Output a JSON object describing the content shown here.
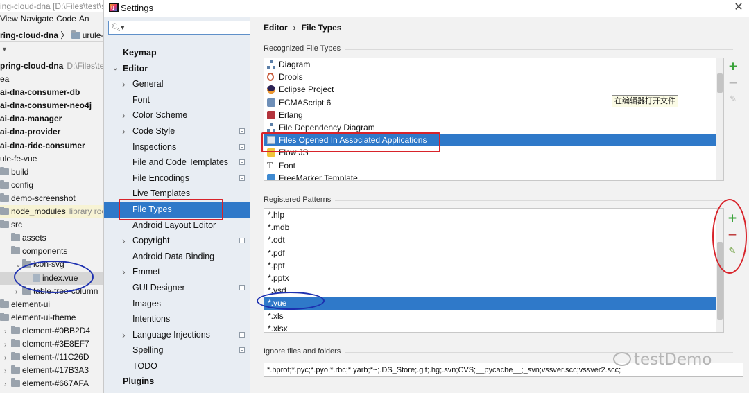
{
  "ide": {
    "title": "ing-cloud-dna [D:\\Files\\test\\sc",
    "menu": [
      "View",
      "Navigate",
      "Code",
      "An"
    ],
    "breadcrumb": {
      "root": "ring-cloud-dna",
      "next": "urule-fe"
    },
    "tree": [
      {
        "label": "pring-cloud-dna",
        "suffix": "D:\\Files\\te",
        "bold": true
      },
      {
        "label": "ea"
      },
      {
        "label": "ai-dna-consumer-db",
        "bold": true
      },
      {
        "label": "ai-dna-consumer-neo4j",
        "bold": true
      },
      {
        "label": "ai-dna-manager",
        "bold": true
      },
      {
        "label": "ai-dna-provider",
        "bold": true
      },
      {
        "label": "ai-dna-ride-consumer",
        "bold": true
      },
      {
        "label": "ule-fe-vue"
      },
      {
        "label": "build",
        "folder": true
      },
      {
        "label": "config",
        "folder": true
      },
      {
        "label": "demo-screenshot",
        "folder": true
      },
      {
        "label": "node_modules",
        "suffix": "library root",
        "folder": true,
        "highlight": true
      },
      {
        "label": "src",
        "folder": true
      },
      {
        "label": "assets",
        "folder": true,
        "indent": 1
      },
      {
        "label": "components",
        "folder": true,
        "indent": 1
      },
      {
        "label": "icon-svg",
        "folder": true,
        "indent": 2,
        "chevron": "down"
      },
      {
        "label": "index.vue",
        "file": true,
        "indent": 3,
        "selected": true
      },
      {
        "label": "table-tree-column",
        "folder": true,
        "indent": 2,
        "chevron": "right"
      },
      {
        "label": "element-ui",
        "folder": true
      },
      {
        "label": "element-ui-theme",
        "folder": true
      },
      {
        "label": "element-#0BB2D4",
        "folder": true,
        "indent": 1,
        "chevron": "right"
      },
      {
        "label": "element-#3E8EF7",
        "folder": true,
        "indent": 1,
        "chevron": "right"
      },
      {
        "label": "element-#11C26D",
        "folder": true,
        "indent": 1,
        "chevron": "right"
      },
      {
        "label": "element-#17B3A3",
        "folder": true,
        "indent": 1,
        "chevron": "right"
      },
      {
        "label": "element-#667AFA",
        "folder": true,
        "indent": 1,
        "chevron": "right"
      }
    ]
  },
  "dialog": {
    "title": "Settings",
    "search": {
      "value": "",
      "placeholder": ""
    },
    "nav": [
      {
        "label": "Keymap",
        "level": 0,
        "bold": true
      },
      {
        "label": "Editor",
        "level": 0,
        "bold": true,
        "chevron": "down"
      },
      {
        "label": "General",
        "level": 1,
        "chevron": "right"
      },
      {
        "label": "Font",
        "level": 1
      },
      {
        "label": "Color Scheme",
        "level": 1,
        "chevron": "right"
      },
      {
        "label": "Code Style",
        "level": 1,
        "chevron": "right",
        "project": true
      },
      {
        "label": "Inspections",
        "level": 1,
        "project": true
      },
      {
        "label": "File and Code Templates",
        "level": 1,
        "project": true
      },
      {
        "label": "File Encodings",
        "level": 1,
        "project": true
      },
      {
        "label": "Live Templates",
        "level": 1
      },
      {
        "label": "File Types",
        "level": 1,
        "selected": true
      },
      {
        "label": "Android Layout Editor",
        "level": 1
      },
      {
        "label": "Copyright",
        "level": 1,
        "chevron": "right",
        "project": true
      },
      {
        "label": "Android Data Binding",
        "level": 1
      },
      {
        "label": "Emmet",
        "level": 1,
        "chevron": "right"
      },
      {
        "label": "GUI Designer",
        "level": 1,
        "project": true
      },
      {
        "label": "Images",
        "level": 1
      },
      {
        "label": "Intentions",
        "level": 1
      },
      {
        "label": "Language Injections",
        "level": 1,
        "chevron": "right",
        "project": true
      },
      {
        "label": "Spelling",
        "level": 1,
        "project": true
      },
      {
        "label": "TODO",
        "level": 1
      },
      {
        "label": "Plugins",
        "level": 0,
        "bold": true
      }
    ],
    "breadcrumb": {
      "parent": "Editor",
      "separator": "›",
      "current": "File Types"
    },
    "recognized": {
      "label": "Recognized File Types",
      "items": [
        {
          "label": "Diagram",
          "icon": "diagram-icon"
        },
        {
          "label": "Drools",
          "icon": "drools-icon"
        },
        {
          "label": "Eclipse Project",
          "icon": "eclipse-icon"
        },
        {
          "label": "ECMAScript 6",
          "icon": "ecmascript-icon"
        },
        {
          "label": "Erlang",
          "icon": "erlang-icon"
        },
        {
          "label": "File Dependency Diagram",
          "icon": "dependency-diagram-icon"
        },
        {
          "label": "Files Opened In Associated Applications",
          "icon": "external-app-icon",
          "selected": true
        },
        {
          "label": "Flow JS",
          "icon": "flow-icon"
        },
        {
          "label": "Font",
          "icon": "font-icon"
        },
        {
          "label": "FreeMarker Template",
          "icon": "freemarker-icon"
        }
      ]
    },
    "tooltip": "在编辑器打开文件",
    "patterns": {
      "label": "Registered Patterns",
      "items": [
        "*.hlp",
        "*.mdb",
        "*.odt",
        "*.pdf",
        "*.ppt",
        "*.pptx",
        "*.vsd",
        "*.vue",
        "*.xls",
        "*.xlsx"
      ],
      "selected_index": 7
    },
    "ignore": {
      "label": "Ignore files and folders",
      "value": "*.hprof;*.pyc;*.pyo;*.rbc;*.yarb;*~;.DS_Store;.git;.hg;.svn;CVS;__pycache__;_svn;vssver.scc;vssver2.scc;"
    },
    "toolbar": {
      "add": "+",
      "remove": "−",
      "edit": "✎"
    }
  },
  "watermark": "testDemo",
  "colors": {
    "selection": "#2f79c9",
    "annotation_red": "#d8232a",
    "annotation_blue": "#1d30b0",
    "add_green": "#3aa33a"
  }
}
